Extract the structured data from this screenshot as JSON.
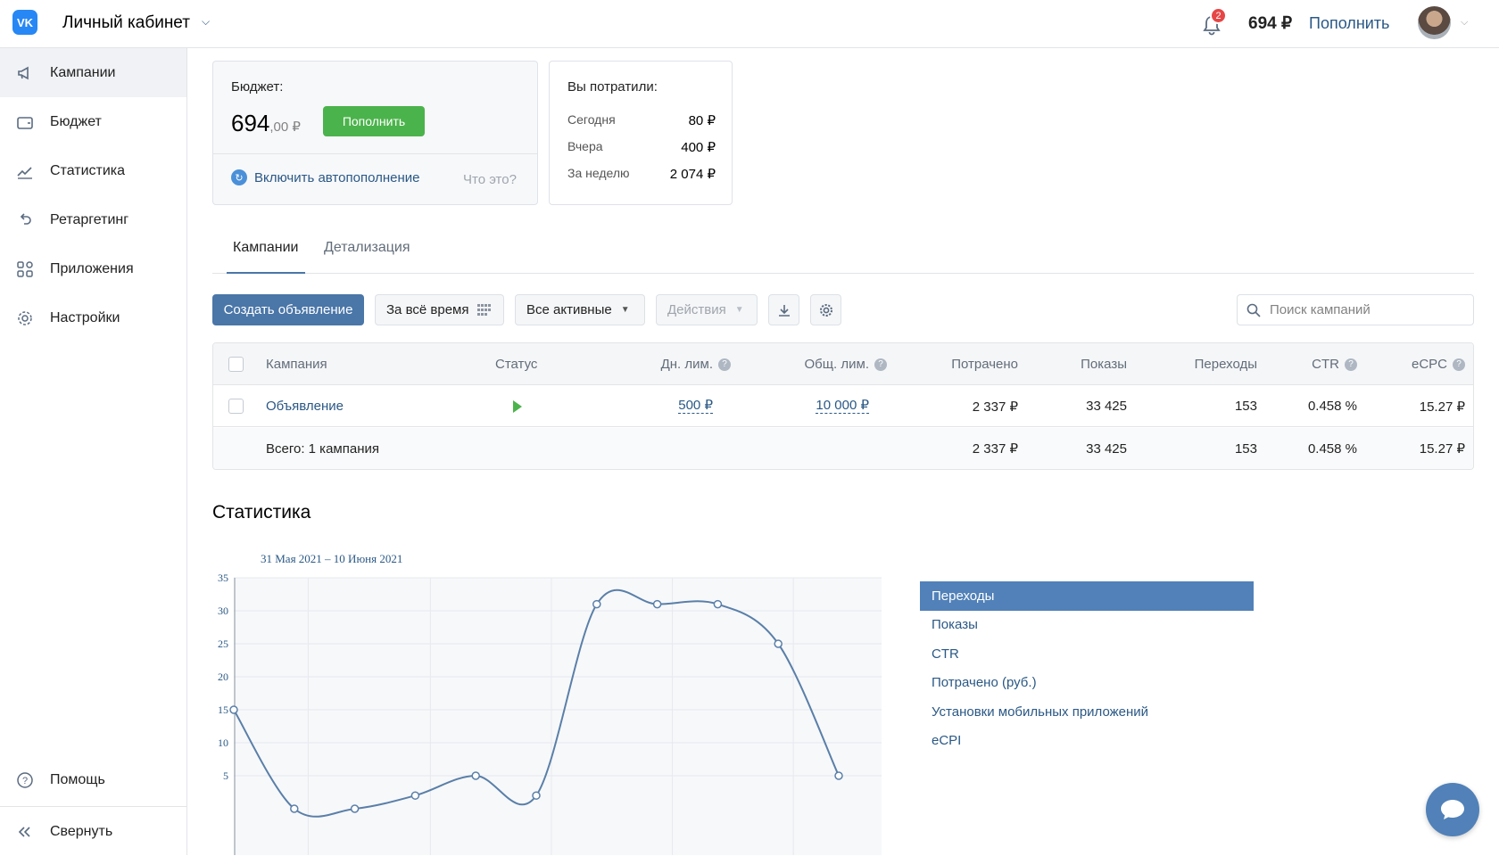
{
  "header": {
    "logo_text": "VK",
    "title": "Личный кабинет",
    "notifications_count": "2",
    "balance": "694 ₽",
    "topup_label": "Пополнить"
  },
  "sidebar": {
    "items": [
      {
        "label": "Кампании",
        "icon": "megaphone-icon",
        "active": true
      },
      {
        "label": "Бюджет",
        "icon": "wallet-icon"
      },
      {
        "label": "Статистика",
        "icon": "chart-line-icon"
      },
      {
        "label": "Ретаргетинг",
        "icon": "retarget-icon"
      },
      {
        "label": "Приложения",
        "icon": "apps-grid-icon"
      },
      {
        "label": "Настройки",
        "icon": "gear-icon"
      }
    ],
    "help_label": "Помощь",
    "collapse_label": "Свернуть"
  },
  "budget": {
    "label": "Бюджет:",
    "amount_int": "694",
    "amount_frac": ",00 ₽",
    "topup_button": "Пополнить",
    "autotopup_label": "Включить автопополнение",
    "what_is": "Что это?"
  },
  "spent": {
    "title": "Вы потратили:",
    "rows": [
      {
        "label": "Сегодня",
        "value": "80 ₽"
      },
      {
        "label": "Вчера",
        "value": "400 ₽"
      },
      {
        "label": "За неделю",
        "value": "2 074 ₽"
      }
    ]
  },
  "tabs": [
    {
      "label": "Кампании",
      "active": true
    },
    {
      "label": "Детализация",
      "active": false
    }
  ],
  "toolbar": {
    "create_label": "Создать объявление",
    "period_label": "За всё время",
    "filter_label": "Все активные",
    "actions_label": "Действия",
    "search_placeholder": "Поиск кампаний"
  },
  "table": {
    "headers": {
      "campaign": "Кампания",
      "status": "Статус",
      "daily_limit": "Дн. лим.",
      "total_limit": "Общ. лим.",
      "spent": "Потрачено",
      "impressions": "Показы",
      "clicks": "Переходы",
      "ctr": "CTR",
      "ecpc": "eCPC"
    },
    "row": {
      "name": "Объявление",
      "daily_limit": "500 ₽",
      "total_limit": "10 000 ₽",
      "spent": "2 337 ₽",
      "impressions": "33 425",
      "clicks": "153",
      "ctr": "0.458 %",
      "ecpc": "15.27 ₽"
    },
    "total": {
      "label": "Всего: 1 кампания",
      "spent": "2 337 ₽",
      "impressions": "33 425",
      "clicks": "153",
      "ctr": "0.458 %",
      "ecpc": "15.27 ₽"
    }
  },
  "stats": {
    "title": "Статистика",
    "range": "31 Мая 2021 – 10 Июня 2021",
    "legend": [
      {
        "label": "Переходы",
        "active": true
      },
      {
        "label": "Показы"
      },
      {
        "label": "CTR"
      },
      {
        "label": "Потрачено (руб.)"
      },
      {
        "label": "Установки мобильных приложений"
      },
      {
        "label": "eCPI"
      }
    ]
  },
  "chart_data": {
    "type": "line",
    "yticks": [
      "35",
      "30",
      "25",
      "20",
      "15",
      "10",
      "5"
    ],
    "ylim": [
      0,
      35
    ],
    "x": [
      0,
      1,
      2,
      3,
      4,
      5,
      6,
      7,
      8,
      9,
      10
    ],
    "series": [
      {
        "values": [
          15,
          0,
          0,
          2,
          5,
          2,
          31,
          31,
          31,
          25,
          5
        ]
      }
    ],
    "grid": true,
    "line_color": "#5a7fa8"
  },
  "colors": {
    "accent": "#4a76a8",
    "link": "#2a5885",
    "success": "#4bb34b",
    "badge": "#e64646"
  }
}
